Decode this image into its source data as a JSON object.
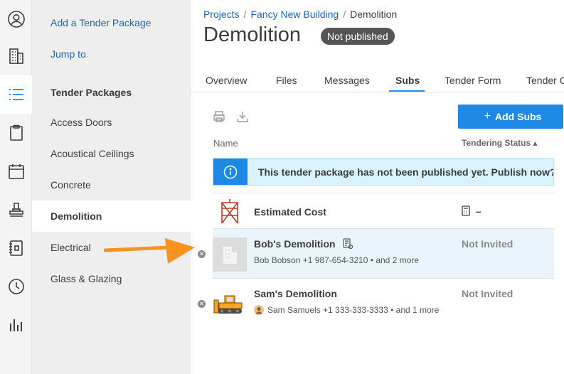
{
  "rail": {
    "icons": [
      "user-circle-icon",
      "building-icon",
      "list-icon",
      "clipboard-icon",
      "calendar-icon",
      "stamp-icon",
      "notebook-icon",
      "clock-icon",
      "bar-chart-icon"
    ],
    "active_index": 2,
    "accent_color": "#1e88e5"
  },
  "sidebar": {
    "add_link": "Add a Tender Package",
    "jump_link": "Jump to",
    "heading": "Tender Packages",
    "items": [
      "Access Doors",
      "Acoustical Ceilings",
      "Concrete",
      "Demolition",
      "Electrical",
      "Glass & Glazing"
    ],
    "active_item": "Demolition"
  },
  "breadcrumb": {
    "projects": "Projects",
    "building": "Fancy New Building",
    "current": "Demolition",
    "separator": "/"
  },
  "page": {
    "title": "Demolition",
    "status_badge": "Not published"
  },
  "tabs": [
    "Overview",
    "Files",
    "Messages",
    "Subs",
    "Tender Form",
    "Tender C"
  ],
  "active_tab": "Subs",
  "toolbar": {
    "add_subs_label": "Add Subs",
    "add_subs_icon": "plus"
  },
  "table": {
    "col_name": "Name",
    "col_status": "Tendering Status",
    "sort_indicator": "▴"
  },
  "banner": {
    "text": "This tender package has not been published yet. Publish now?",
    "icon": "info-icon",
    "color": "#1e88e5"
  },
  "rows": [
    {
      "title": "Estimated Cost",
      "status_value": "–",
      "status_icon": "calculator-icon"
    },
    {
      "title": "Bob's Demolition",
      "subtitle": "Bob Bobson +1 987-654-3210 • and 2 more",
      "status": "Not Invited",
      "title_icon": "document-badge-icon"
    },
    {
      "title": "Sam's Demolition",
      "subtitle": "Sam Samuels +1 333-333-3333 • and 1 more",
      "status": "Not Invited"
    }
  ],
  "annotation": {
    "arrow_color": "#f7931e"
  }
}
